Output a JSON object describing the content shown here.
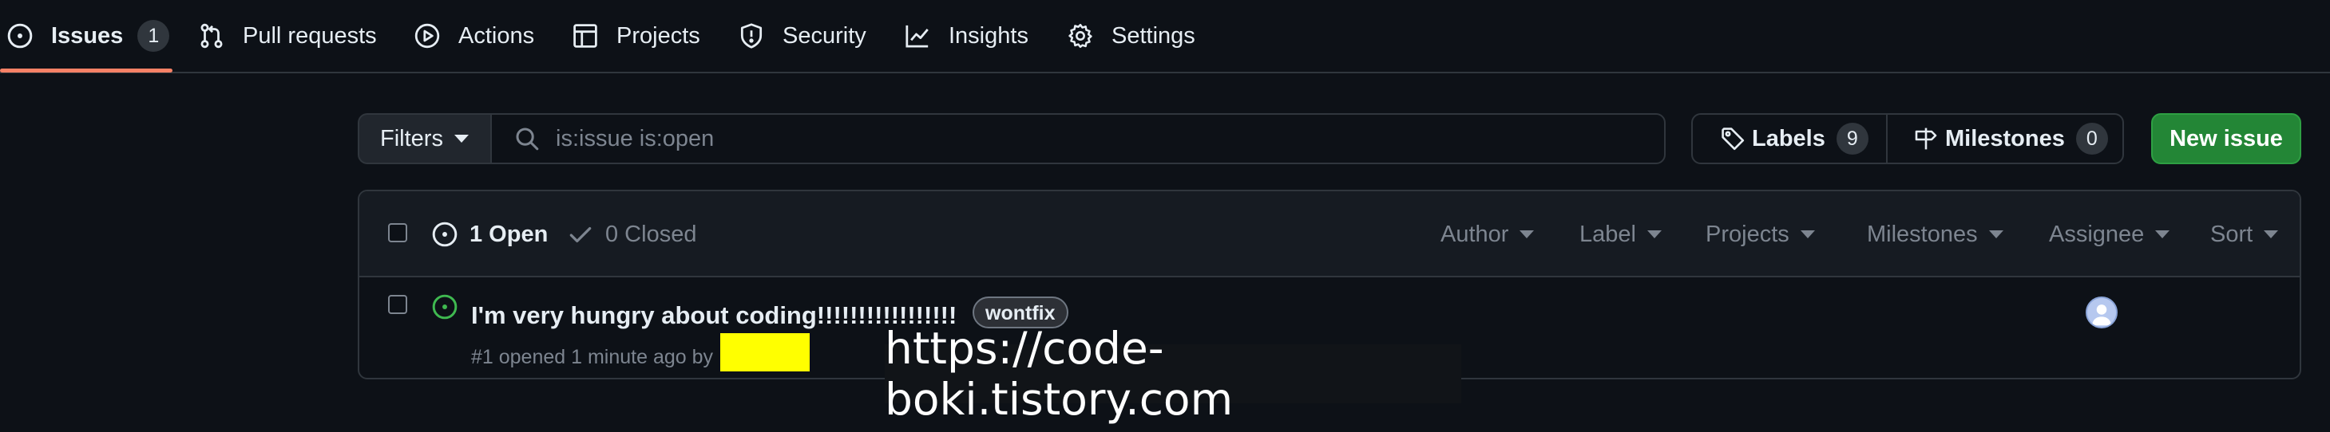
{
  "nav": {
    "tabs": [
      {
        "label": "Issues",
        "icon": "issue-opened-icon",
        "count": "1",
        "active": true
      },
      {
        "label": "Pull requests",
        "icon": "pull-request-icon"
      },
      {
        "label": "Actions",
        "icon": "play-icon"
      },
      {
        "label": "Projects",
        "icon": "table-icon"
      },
      {
        "label": "Security",
        "icon": "shield-icon"
      },
      {
        "label": "Insights",
        "icon": "graph-icon"
      },
      {
        "label": "Settings",
        "icon": "gear-icon"
      }
    ]
  },
  "toolbar": {
    "filters_label": "Filters",
    "search_value": "is:issue is:open",
    "labels_label": "Labels",
    "labels_count": "9",
    "milestones_label": "Milestones",
    "milestones_count": "0",
    "new_issue_label": "New issue"
  },
  "list": {
    "open_label": "1 Open",
    "closed_label": "0 Closed",
    "filters": [
      "Author",
      "Label",
      "Projects",
      "Milestones",
      "Assignee",
      "Sort"
    ],
    "issues": [
      {
        "title": "I'm very hungry about coding!!!!!!!!!!!!!!!!!",
        "label": "wontfix",
        "meta": "#1 opened 1 minute ago by"
      }
    ]
  },
  "overlay": {
    "watermark": "https://code-boki.tistory.com"
  },
  "colors": {
    "background": "#0d1117",
    "accent_underline": "#f78166",
    "new_issue_button": "#238636",
    "open_issue_icon": "#3fb950",
    "redaction": "#ffff00"
  }
}
